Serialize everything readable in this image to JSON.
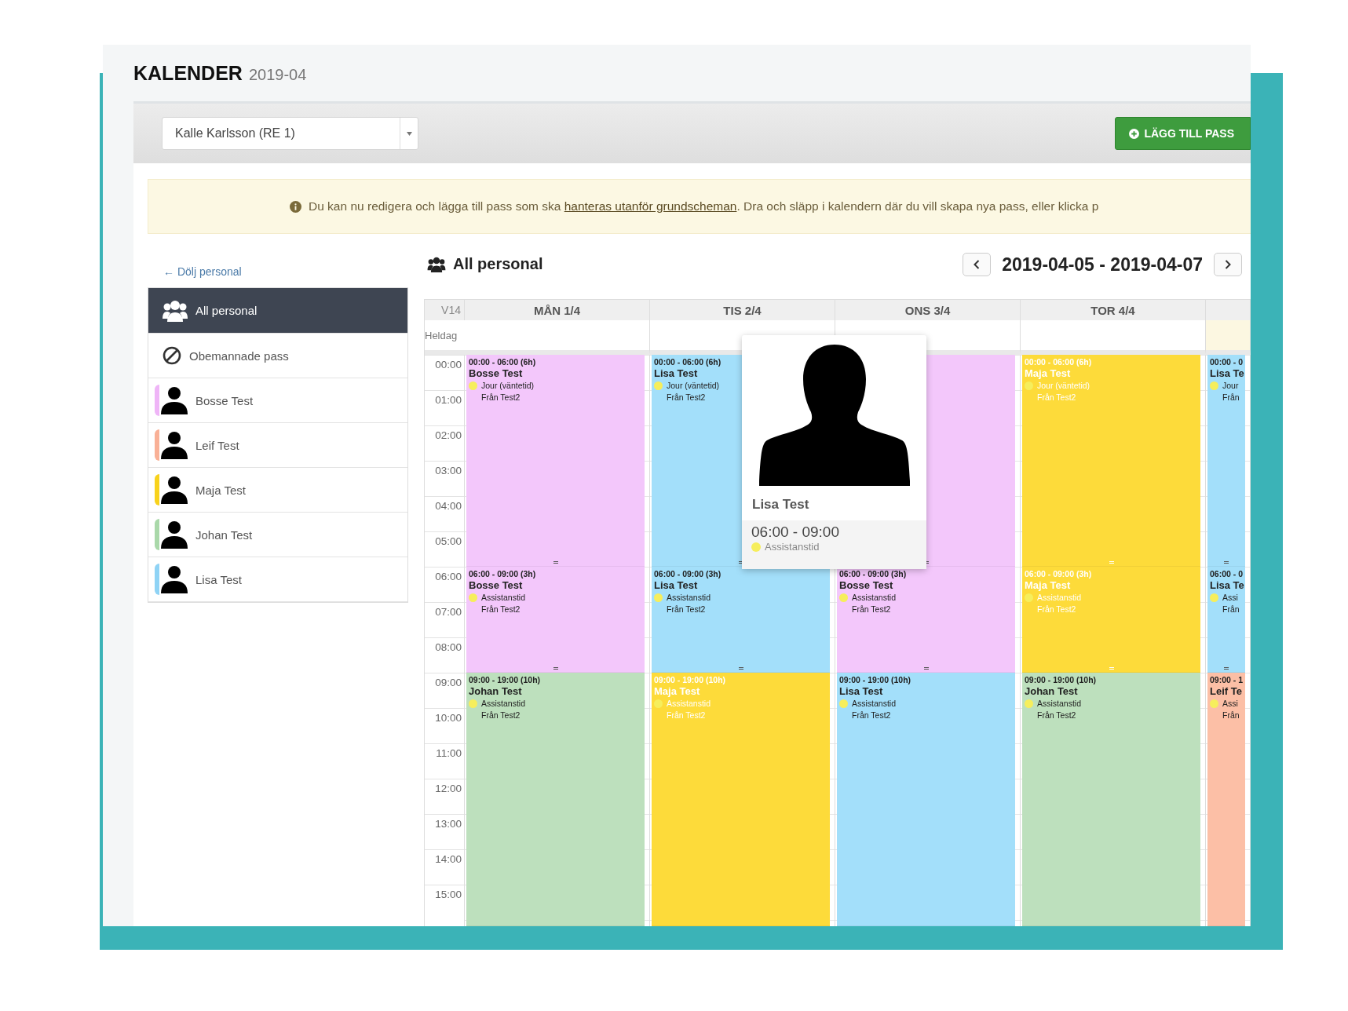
{
  "title": {
    "text": "KALENDER",
    "period": "2019-04"
  },
  "toolbar": {
    "staff_select": {
      "value": "Kalle Karlsson (RE 1)"
    },
    "add_button": "LÄGG TILL PASS"
  },
  "alert": {
    "before": "Du kan nu redigera och lägga till pass som ska ",
    "link": "hanteras utanför grundscheman",
    "after": ". Dra och släpp i kalendern där du vill skapa nya pass, eller klicka p"
  },
  "sidebar": {
    "hide_link": "← Dölj personal",
    "items": [
      {
        "kind": "group",
        "label": "All personal",
        "selected": true
      },
      {
        "kind": "unstaffed",
        "label": "Obemannade pass",
        "selected": false
      },
      {
        "kind": "person",
        "label": "Bosse Test",
        "color": "#efb5f7",
        "selected": false
      },
      {
        "kind": "person",
        "label": "Leif Test",
        "color": "#f9b096",
        "selected": false
      },
      {
        "kind": "person",
        "label": "Maja Test",
        "color": "#f8d21c",
        "selected": false
      },
      {
        "kind": "person",
        "label": "Johan Test",
        "color": "#a9d8a9",
        "selected": false
      },
      {
        "kind": "person",
        "label": "Lisa Test",
        "color": "#8fd3f5",
        "selected": false
      }
    ]
  },
  "calendar": {
    "heading": "All personal",
    "range": "2019-04-05 - 2019-04-07",
    "week": "V14",
    "allday_label": "Heldag",
    "hours": [
      "00:00",
      "01:00",
      "02:00",
      "03:00",
      "04:00",
      "05:00",
      "06:00",
      "07:00",
      "08:00",
      "09:00",
      "10:00",
      "11:00",
      "12:00",
      "13:00",
      "14:00",
      "15:00"
    ],
    "days": [
      {
        "label": "MÅN 1/4",
        "today": false,
        "events": [
          {
            "time": "00:00 - 06:00 (6h)",
            "name": "Bosse Test",
            "type": "Jour (väntetid)",
            "from": "Från Test2",
            "color": "#f3c7fb",
            "light_text": false
          },
          {
            "time": "06:00 - 09:00 (3h)",
            "name": "Bosse Test",
            "type": "Assistanstid",
            "from": "Från Test2",
            "color": "#f3c7fb",
            "light_text": false
          },
          {
            "time": "09:00 - 19:00 (10h)",
            "name": "Johan Test",
            "type": "Assistanstid",
            "from": "Från Test2",
            "color": "#bde0bd",
            "light_text": false
          }
        ]
      },
      {
        "label": "TIS 2/4",
        "today": false,
        "events": [
          {
            "time": "00:00 - 06:00 (6h)",
            "name": "Lisa Test",
            "type": "Jour (väntetid)",
            "from": "Från Test2",
            "color": "#a3dffa",
            "light_text": false
          },
          {
            "time": "06:00 - 09:00 (3h)",
            "name": "Lisa Test",
            "type": "Assistanstid",
            "from": "Från Test2",
            "color": "#a3dffa",
            "light_text": false
          },
          {
            "time": "09:00 - 19:00 (10h)",
            "name": "Maja Test",
            "type": "Assistanstid",
            "from": "Från Test2",
            "color": "#fddb3a",
            "light_text": true
          }
        ]
      },
      {
        "label": "ONS 3/4",
        "today": false,
        "events": [
          {
            "color": "#f3c7fb"
          },
          {
            "time": "06:00 - 09:00 (3h)",
            "name": "Bosse Test",
            "type": "Assistanstid",
            "from": "Från Test2",
            "color": "#f3c7fb",
            "light_text": false
          },
          {
            "time": "09:00 - 19:00 (10h)",
            "name": "Lisa Test",
            "type": "Assistanstid",
            "from": "Från Test2",
            "color": "#a3dffa",
            "light_text": false
          }
        ]
      },
      {
        "label": "TOR 4/4",
        "today": false,
        "events": [
          {
            "time": "00:00 - 06:00 (6h)",
            "name": "Maja Test",
            "type": "Jour (väntetid)",
            "from": "Från Test2",
            "color": "#fddb3a",
            "light_text": true
          },
          {
            "time": "06:00 - 09:00 (3h)",
            "name": "Maja Test",
            "type": "Assistanstid",
            "from": "Från Test2",
            "color": "#fddb3a",
            "light_text": true
          },
          {
            "time": "09:00 - 19:00 (10h)",
            "name": "Johan Test",
            "type": "Assistanstid",
            "from": "Från Test2",
            "color": "#bde0bd",
            "light_text": false
          }
        ]
      },
      {
        "today": true,
        "events": [
          {
            "time": "00:00 - 0",
            "name": "Lisa Te",
            "type": "Jour",
            "from": "Från",
            "color": "#a3dffa",
            "light_text": false
          },
          {
            "time": "06:00 - 0",
            "name": "Lisa Te",
            "type": "Assi",
            "from": "Från",
            "color": "#a3dffa",
            "light_text": false
          },
          {
            "time": "09:00 - 1",
            "name": "Leif Te",
            "type": "Assi",
            "from": "Från",
            "color": "#fcbfa6",
            "light_text": false
          }
        ]
      }
    ]
  },
  "popover": {
    "name": "Lisa Test",
    "time": "06:00 - 09:00",
    "type": "Assistanstid"
  }
}
